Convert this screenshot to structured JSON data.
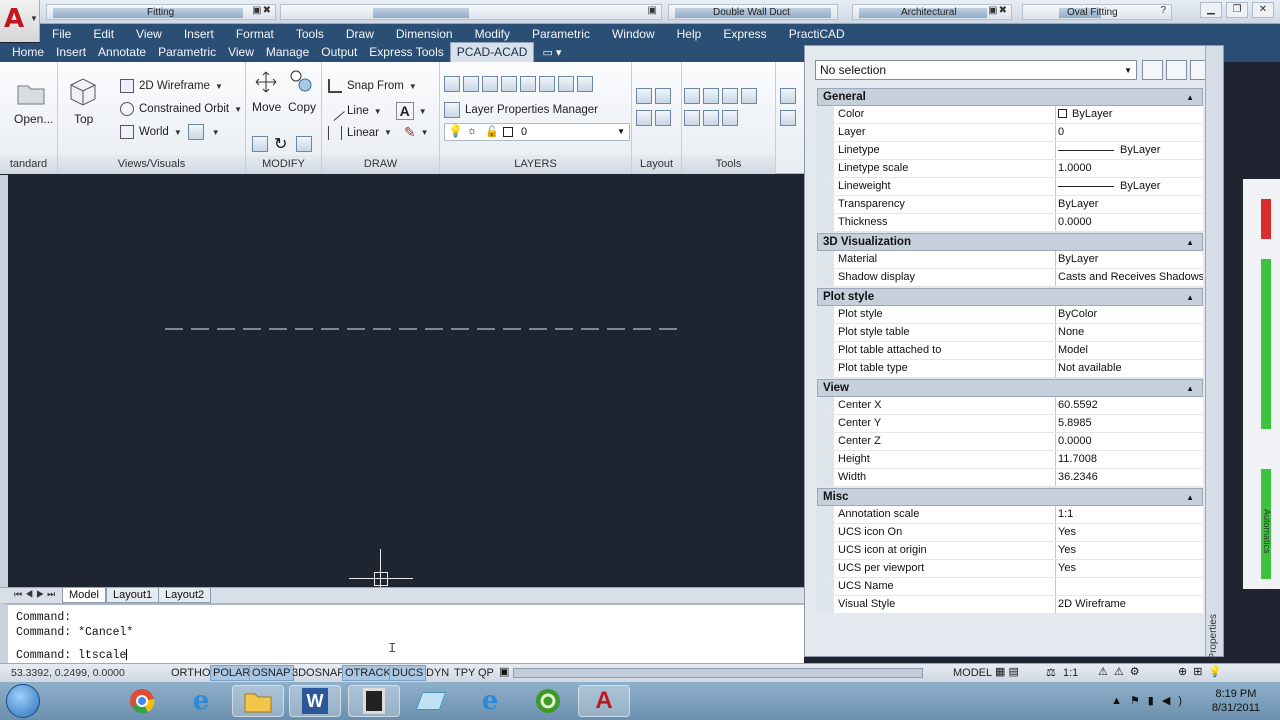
{
  "title_bar": {
    "palettes": [
      {
        "label": "Fitting"
      },
      {
        "label": "Double Wall Duct"
      },
      {
        "label": "Architectural"
      },
      {
        "label": "Oval Fitting"
      }
    ],
    "help_glyph": "?"
  },
  "menu": [
    "File",
    "Edit",
    "View",
    "Insert",
    "Format",
    "Tools",
    "Draw",
    "Dimension",
    "Modify",
    "Parametric",
    "Window",
    "Help",
    "Express",
    "PractiCAD"
  ],
  "ribbon_tabs": [
    "Home",
    "Insert",
    "Annotate",
    "Parametric",
    "View",
    "Manage",
    "Output",
    "Express Tools",
    "PCAD-ACAD"
  ],
  "active_tab": "PCAD-ACAD",
  "ribbon": {
    "standard": {
      "title": "tandard",
      "open_label": "Open..."
    },
    "views": {
      "title": "Views/Visuals",
      "top_label": "Top",
      "visual_style": "2D Wireframe",
      "orbit": "Constrained Orbit",
      "ucs": "World"
    },
    "modify": {
      "title": "MODIFY",
      "move": "Move",
      "copy": "Copy"
    },
    "draw": {
      "title": "DRAW",
      "snap": "Snap From",
      "line": "Line",
      "linear": "Linear"
    },
    "layers": {
      "title": "LAYERS",
      "manager": "Layer Properties Manager",
      "current_layer": "0"
    },
    "layout": {
      "title": "Layout"
    },
    "tools": {
      "title": "Tools"
    }
  },
  "layout_tabs": [
    "Model",
    "Layout1",
    "Layout2"
  ],
  "active_layout": "Model",
  "command_line": {
    "history": [
      "Command:",
      "Command: *Cancel*"
    ],
    "prompt": "Command: ltscale"
  },
  "status_bar": {
    "coordinates": "53.3392, 0.2499, 0.0000",
    "toggles": [
      {
        "label": "ORTHO",
        "on": false
      },
      {
        "label": "POLAR",
        "on": true
      },
      {
        "label": "OSNAP",
        "on": true
      },
      {
        "label": "3DOSNAP",
        "on": false
      },
      {
        "label": "OTRACK",
        "on": true
      },
      {
        "label": "DUCS",
        "on": true
      },
      {
        "label": "DYN",
        "on": false
      },
      {
        "label": "TPY",
        "on": false
      },
      {
        "label": "QP",
        "on": false
      }
    ],
    "space": "MODEL",
    "annotation_scale": "1:1"
  },
  "taskbar": {
    "apps": [
      "start-button",
      "chrome-icon",
      "ie-icon",
      "explorer-icon",
      "word-icon",
      "film-icon",
      "notepad-icon",
      "ie-icon-2",
      "app-icon",
      "autocad-icon"
    ],
    "time": "8:19 PM",
    "date": "8/31/2011"
  },
  "properties": {
    "selection": "No selection",
    "side_label": "Properties",
    "categories": [
      {
        "name": "General",
        "rows": [
          {
            "name": "Color",
            "value": "ByLayer",
            "kind": "color"
          },
          {
            "name": "Layer",
            "value": "0"
          },
          {
            "name": "Linetype",
            "value": "ByLayer",
            "kind": "line"
          },
          {
            "name": "Linetype scale",
            "value": "1.0000"
          },
          {
            "name": "Lineweight",
            "value": "ByLayer",
            "kind": "line"
          },
          {
            "name": "Transparency",
            "value": "ByLayer"
          },
          {
            "name": "Thickness",
            "value": "0.0000"
          }
        ]
      },
      {
        "name": "3D Visualization",
        "rows": [
          {
            "name": "Material",
            "value": "ByLayer"
          },
          {
            "name": "Shadow display",
            "value": "Casts and Receives Shadows"
          }
        ]
      },
      {
        "name": "Plot style",
        "rows": [
          {
            "name": "Plot style",
            "value": "ByColor"
          },
          {
            "name": "Plot style table",
            "value": "None"
          },
          {
            "name": "Plot table attached to",
            "value": "Model"
          },
          {
            "name": "Plot table type",
            "value": "Not available"
          }
        ]
      },
      {
        "name": "View",
        "rows": [
          {
            "name": "Center X",
            "value": "60.5592"
          },
          {
            "name": "Center Y",
            "value": "5.8985"
          },
          {
            "name": "Center Z",
            "value": "0.0000"
          },
          {
            "name": "Height",
            "value": "11.7008"
          },
          {
            "name": "Width",
            "value": "36.2346"
          }
        ]
      },
      {
        "name": "Misc",
        "rows": [
          {
            "name": "Annotation scale",
            "value": "1:1"
          },
          {
            "name": "UCS icon On",
            "value": "Yes"
          },
          {
            "name": "UCS icon at origin",
            "value": "Yes"
          },
          {
            "name": "UCS per viewport",
            "value": "Yes"
          },
          {
            "name": "UCS Name",
            "value": ""
          },
          {
            "name": "Visual Style",
            "value": "2D Wireframe"
          }
        ]
      }
    ]
  },
  "right_edge_label": "Automatics",
  "colors": {
    "drawing_background": "#1e2430",
    "menu_bar": "#2b4f74",
    "status_toggle_on": "#a9c6e3",
    "autocad_red": "#c3161c"
  }
}
